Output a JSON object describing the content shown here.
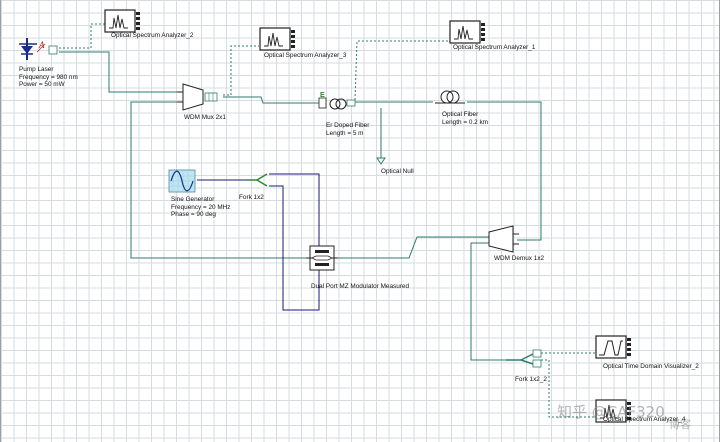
{
  "components": {
    "pump_laser": {
      "name": "Pump Laser",
      "param1": "Frequency = 980  nm",
      "param2": "Power = 50  mW"
    },
    "osa2": {
      "name": "Optical Spectrum Analyzer_2"
    },
    "osa3": {
      "name": "Optical Spectrum Analyzer_3"
    },
    "osa1": {
      "name": "Optical Spectrum Analyzer_1"
    },
    "wdm_mux": {
      "name": "WDM Mux 2x1"
    },
    "edf": {
      "name": "Er Doped Fiber",
      "param1": "Length = 5  m"
    },
    "fiber": {
      "name": "Optical Fiber",
      "param1": "Length = 0.2  km"
    },
    "null": {
      "name": "Optical Null"
    },
    "sine": {
      "name": "Sine Generator",
      "param1": "Frequency = 20  MHz",
      "param2": "Phase = 90  deg"
    },
    "fork1": {
      "name": "Fork 1x2"
    },
    "mz": {
      "name": "Dual Port MZ Modulator Measured"
    },
    "demux": {
      "name": "WDM Demux 1x2"
    },
    "fork2": {
      "name": "Fork 1x2_2"
    },
    "otdv": {
      "name": "Optical Time Domain Visualizer_2"
    },
    "osa4": {
      "name": "Optical Spectrum Analyzer_4"
    }
  },
  "watermark": {
    "text": "知乎 @CAF320",
    "text2": "博客"
  },
  "colors": {
    "optical_wire": "#2e7d6b",
    "electrical_wire": "#1e1a6e",
    "monitor_wire": "#2e7d6b",
    "grid": "#d7dce2"
  }
}
